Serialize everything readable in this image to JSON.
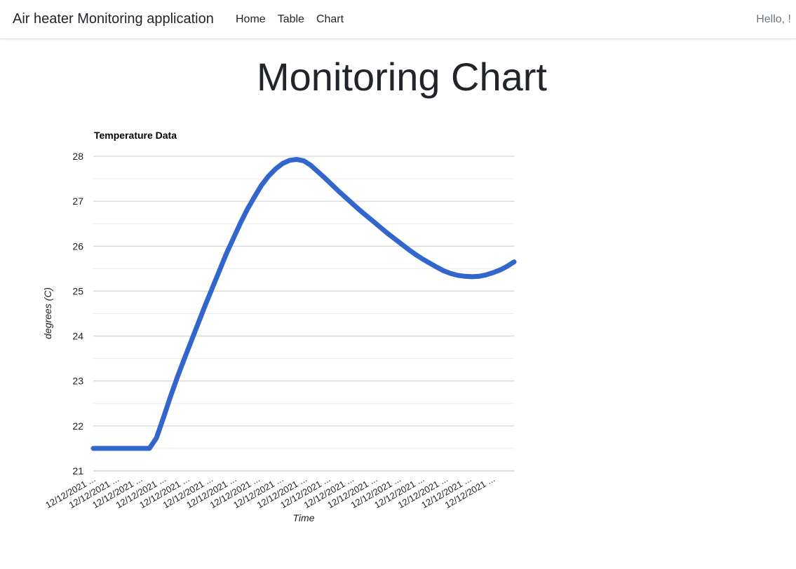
{
  "navbar": {
    "brand": "Air heater Monitoring application",
    "links": [
      "Home",
      "Table",
      "Chart"
    ],
    "greeting": "Hello, !"
  },
  "page": {
    "title": "Monitoring Chart"
  },
  "chart_data": {
    "type": "line",
    "title": "Temperature Data",
    "xlabel": "Time",
    "ylabel": "degrees (C)",
    "ylim": [
      21,
      28
    ],
    "yticks": [
      21,
      22,
      23,
      24,
      25,
      26,
      27,
      28
    ],
    "minor_gridlines": true,
    "x_tick_labels": [
      "12/12/2021 ...",
      "12/12/2021 ...",
      "12/12/2021 ...",
      "12/12/2021 ...",
      "12/12/2021 ...",
      "12/12/2021 ...",
      "12/12/2021 ...",
      "12/12/2021 ...",
      "12/12/2021 ...",
      "12/12/2021 ...",
      "12/12/2021 ...",
      "12/12/2021 ...",
      "12/12/2021 ...",
      "12/12/2021 ...",
      "12/12/2021 ...",
      "12/12/2021 ...",
      "12/12/2021 ...",
      "12/12/2021 ..."
    ],
    "series_color": "#3366cc",
    "series": [
      {
        "values": [
          21.5,
          21.5,
          21.5,
          21.5,
          21.5,
          21.5,
          21.5,
          21.5,
          21.5,
          21.73,
          22.18,
          22.65,
          23.09,
          23.5,
          23.9,
          24.3,
          24.7,
          25.08,
          25.46,
          25.84,
          26.18,
          26.52,
          26.83,
          27.1,
          27.36,
          27.56,
          27.72,
          27.84,
          27.91,
          27.93,
          27.9,
          27.8,
          27.66,
          27.52,
          27.37,
          27.22,
          27.08,
          26.94,
          26.8,
          26.67,
          26.54,
          26.41,
          26.28,
          26.16,
          26.04,
          25.92,
          25.81,
          25.71,
          25.62,
          25.53,
          25.45,
          25.39,
          25.35,
          25.33,
          25.32,
          25.33,
          25.36,
          25.41,
          25.47,
          25.55,
          25.65
        ]
      }
    ],
    "line_width": 7
  }
}
